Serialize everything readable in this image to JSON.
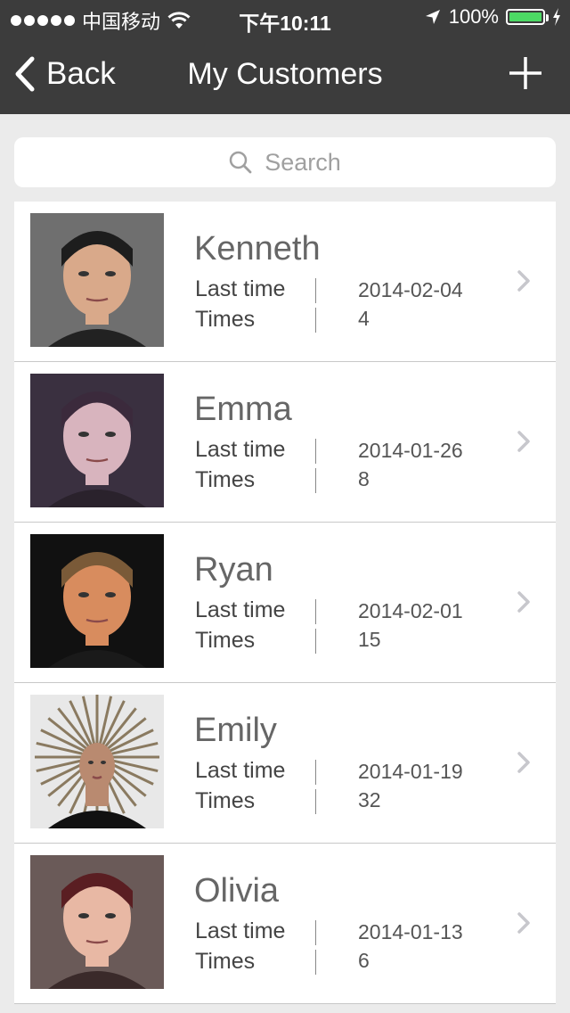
{
  "status_bar": {
    "carrier": "中国移动",
    "time": "下午10:11",
    "battery_percent": "100%",
    "battery_level": 1.0,
    "battery_color": "#4cd964"
  },
  "nav": {
    "back_label": "Back",
    "title": "My Customers",
    "add_icon": "plus-icon"
  },
  "search": {
    "placeholder": "Search",
    "icon": "search-icon"
  },
  "customer_fields": {
    "last_time_label": "Last time",
    "times_label": "Times"
  },
  "customers": [
    {
      "name": "Kenneth",
      "last_time": "2014-02-04",
      "times": "4"
    },
    {
      "name": "Emma",
      "last_time": "2014-01-26",
      "times": "8"
    },
    {
      "name": "Ryan",
      "last_time": "2014-02-01",
      "times": "15"
    },
    {
      "name": "Emily",
      "last_time": "2014-01-19",
      "times": "32"
    },
    {
      "name": "Olivia",
      "last_time": "2014-01-13",
      "times": "6"
    }
  ],
  "colors": {
    "header_bg": "#3c3c3c",
    "page_bg": "#ebebeb",
    "chevron": "#c7c7cc"
  }
}
